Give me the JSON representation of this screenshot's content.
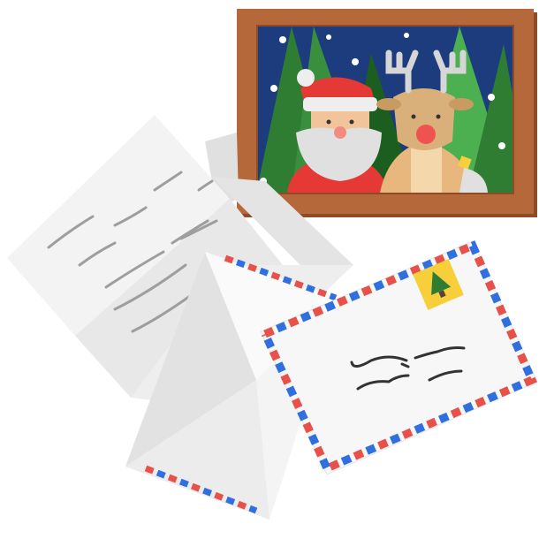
{
  "colors": {
    "frame": "#b5683a",
    "frame_dark": "#8e4b26",
    "sky": "#1d3c7e",
    "tree": "#3a8f3e",
    "santa_red": "#e53935",
    "reindeer": "#d9b07a",
    "nose": "#ef5350",
    "airmail_red": "#e8504a",
    "airmail_blue": "#2f6fe0",
    "stamp": "#f7cf3b",
    "paper": "#f5f5f5"
  },
  "icons": [
    "picture-frame-icon",
    "letter-icon",
    "envelope-icon",
    "stamp-tree-icon"
  ]
}
